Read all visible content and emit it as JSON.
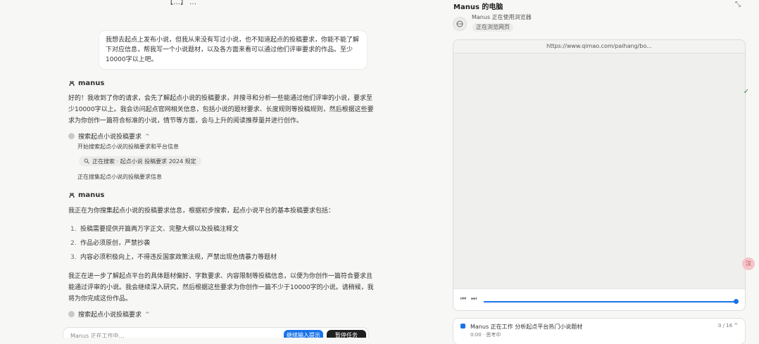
{
  "header": {
    "title": "【…】 …"
  },
  "user_message": "我想去起点上发布小说，但我从来没有写过小说，也不知道起点的投稿要求，你能不能了解下对应信息，帮我写一个小说题材，以及各方面来看可以通过他们评审要求的作品。至少10000字以上吧。",
  "agent_name": "manus",
  "agent_reply_1": "好的！我收到了你的请求，会先了解起点小说的投稿要求，并搜寻和分析一些能通过他们评审的小说，要求至少10000字以上。我会访问起点官网相关信息，包括小说的题材要求、长度规则等投稿规则，然后根据这些要求为你创作一篇符合标准的小说，情节等方面，会与上升的阅读推荐量并进行创作。",
  "step_1": {
    "label": "搜索起点小说投稿要求",
    "substep_1": "开始搜索起点小说的投稿要求和平台信息",
    "chip": "正在搜索 · 起点小说 投稿要求 2024 规定",
    "substep_2": "正在搜集起点小说的投稿要求信息"
  },
  "agent_reply_2": "我正在为你搜集起点小说的投稿要求信息，根据初步搜索，起点小说平台的基本投稿要求包括：",
  "requirements": [
    {
      "num": "1.",
      "text": "投稿需要提供开篇两万字正文、完整大纲以及投稿注释文"
    },
    {
      "num": "2.",
      "text": "作品必须原创，严禁抄袭"
    },
    {
      "num": "3.",
      "text": "内容必须积极向上，不得违反国家政策法规，严禁出现色情暴力等题材"
    }
  ],
  "agent_reply_3": "我正在进一步了解起点平台的具体题材偏好、字数要求、内容限制等投稿信息，以便为你创作一篇符合要求且能通过评审的小说。我会继续深入研究，然后根据这些要求为你创作一篇不少于10000字的小说。请稍候，我将为你完成这份作品。",
  "step_2": {
    "label": "搜索起点小说投稿要求"
  },
  "input": {
    "placeholder": "Manus 正在工作中…",
    "btn_blue": "继续输入提示",
    "btn_dark": "暂停任务"
  },
  "right_panel": {
    "title": "Manus 的电脑",
    "status_line": "Manus 正在使用浏览器",
    "status_chip": "正在浏览网页",
    "url": "https://www.qimao.com/paihang/bo...",
    "progress": 1.0,
    "task": {
      "text": "Manus 正在工作 分析起点平台热门小说题材",
      "sub": "0:00 · 思考中",
      "count": "0 / 16"
    }
  },
  "colors": {
    "accent": "#1a73e8",
    "dark": "#1f1f1f"
  },
  "icons": {
    "close": "collapse-icon",
    "globe": "globe-icon"
  }
}
